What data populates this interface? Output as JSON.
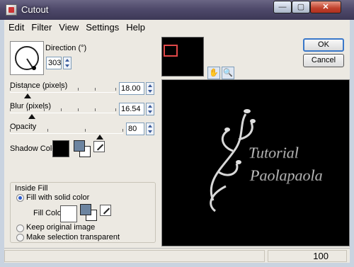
{
  "window": {
    "title": "Cutout",
    "min": "—",
    "max": "▢",
    "close": "✕"
  },
  "menu": [
    "Edit",
    "Filter",
    "View",
    "Settings",
    "Help"
  ],
  "direction": {
    "label": "Direction (°)",
    "value": "303"
  },
  "distance": {
    "label": "Distance (pixels)",
    "value": "18.00"
  },
  "blur": {
    "label": "Blur (pixels)",
    "value": "16.54"
  },
  "opacity": {
    "label": "Opacity",
    "value": "80"
  },
  "shadow_color": {
    "label": "Shadow Color",
    "color": "#000000"
  },
  "inside_fill": {
    "title": "Inside Fill",
    "options": [
      "Fill with solid color",
      "Keep original image",
      "Make selection transparent"
    ],
    "selected": 0,
    "fill_color_label": "Fill Color",
    "fill_color": "#ffffff"
  },
  "buttons": {
    "ok": "OK",
    "cancel": "Cancel"
  },
  "preview_text": {
    "line1": "Tutorial",
    "line2": "Paolapaola"
  },
  "status": {
    "zoom": "100"
  }
}
